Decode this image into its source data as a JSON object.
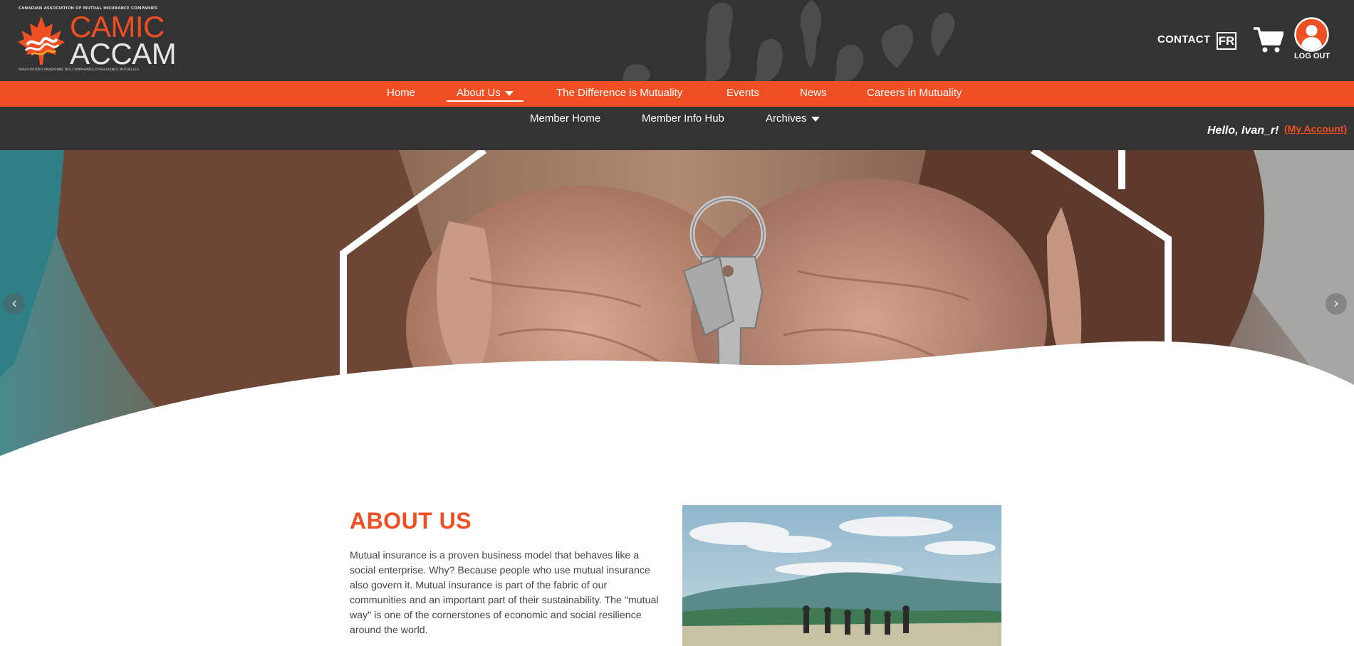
{
  "logo": {
    "top_line": "CANADIAN ASSOCIATION OF MUTUAL INSURANCE COMPANIES",
    "name_en": "CAMIC",
    "name_fr": "ACCAM",
    "bottom_line": "ASSOCIATION CANADIENNE DES COMPAGNIES D'ASSURANCE MUTUELLES"
  },
  "header": {
    "contact_label": "CONTACT",
    "language_label": "FR",
    "logout_label": "LOG OUT",
    "icons": [
      "cart-icon",
      "user-icon"
    ]
  },
  "main_nav": [
    {
      "label": "Home",
      "active": false
    },
    {
      "label": "About Us",
      "active": true,
      "dropdown": true
    },
    {
      "label": "The Difference is Mutuality",
      "active": false
    },
    {
      "label": "Events",
      "active": false
    },
    {
      "label": "News",
      "active": false
    },
    {
      "label": "Careers in Mutuality",
      "active": false
    }
  ],
  "sub_nav": [
    {
      "label": "Member Home"
    },
    {
      "label": "Member Info Hub"
    },
    {
      "label": "Archives",
      "dropdown": true
    }
  ],
  "user": {
    "greeting": "Hello, Ivan_r!",
    "account_link": "(My Account)"
  },
  "hero": {
    "prev_icon": "chevron-left-icon",
    "next_icon": "chevron-right-icon",
    "prev_glyph": "‹",
    "next_glyph": "›"
  },
  "about": {
    "title": "ABOUT US",
    "body": "Mutual insurance is a proven business model that behaves like a social enterprise. Why? Because people who use mutual insurance also govern it. Mutual insurance is part of the fabric of our communities and an important part of their sustainability. The \"mutual way\" is one of the cornerstones of economic and social resilience around the world."
  },
  "colors": {
    "brand_orange": "#f04e23",
    "header_dark": "#333333",
    "text_gray": "#444444"
  }
}
